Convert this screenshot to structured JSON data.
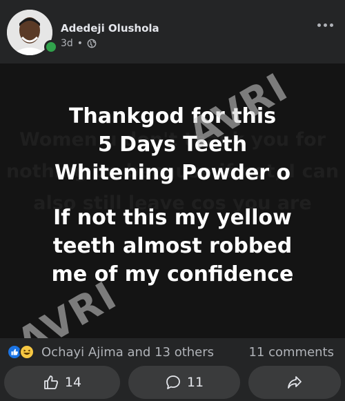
{
  "post": {
    "author": "Adedeji Olushola",
    "time": "3d",
    "separator": "•",
    "visibility_icon": "globe-icon",
    "more_icon": "more-options-icon"
  },
  "content": {
    "line1": "Thankgod for this",
    "line2": "5 Days Teeth",
    "line3": "Whitening Powder o",
    "line4": "If not this my yellow",
    "line5": "teeth almost robbed",
    "line6": "me of my confidence",
    "faded1": "Women u don't thank you for",
    "faded2": "nothing oo because if not, I can",
    "faded3": "also still leave cos you are",
    "watermark": "AVRI",
    "background_color": "#141414"
  },
  "reactions": {
    "text": "Ochayi Ajima and 13 others",
    "comments": "11 comments",
    "icons": [
      "like-icon",
      "haha-icon"
    ]
  },
  "actions": {
    "like_count": "14",
    "comment_count": "11",
    "like_icon": "thumbs-up-icon",
    "comment_icon": "comment-icon",
    "share_icon": "share-icon"
  }
}
